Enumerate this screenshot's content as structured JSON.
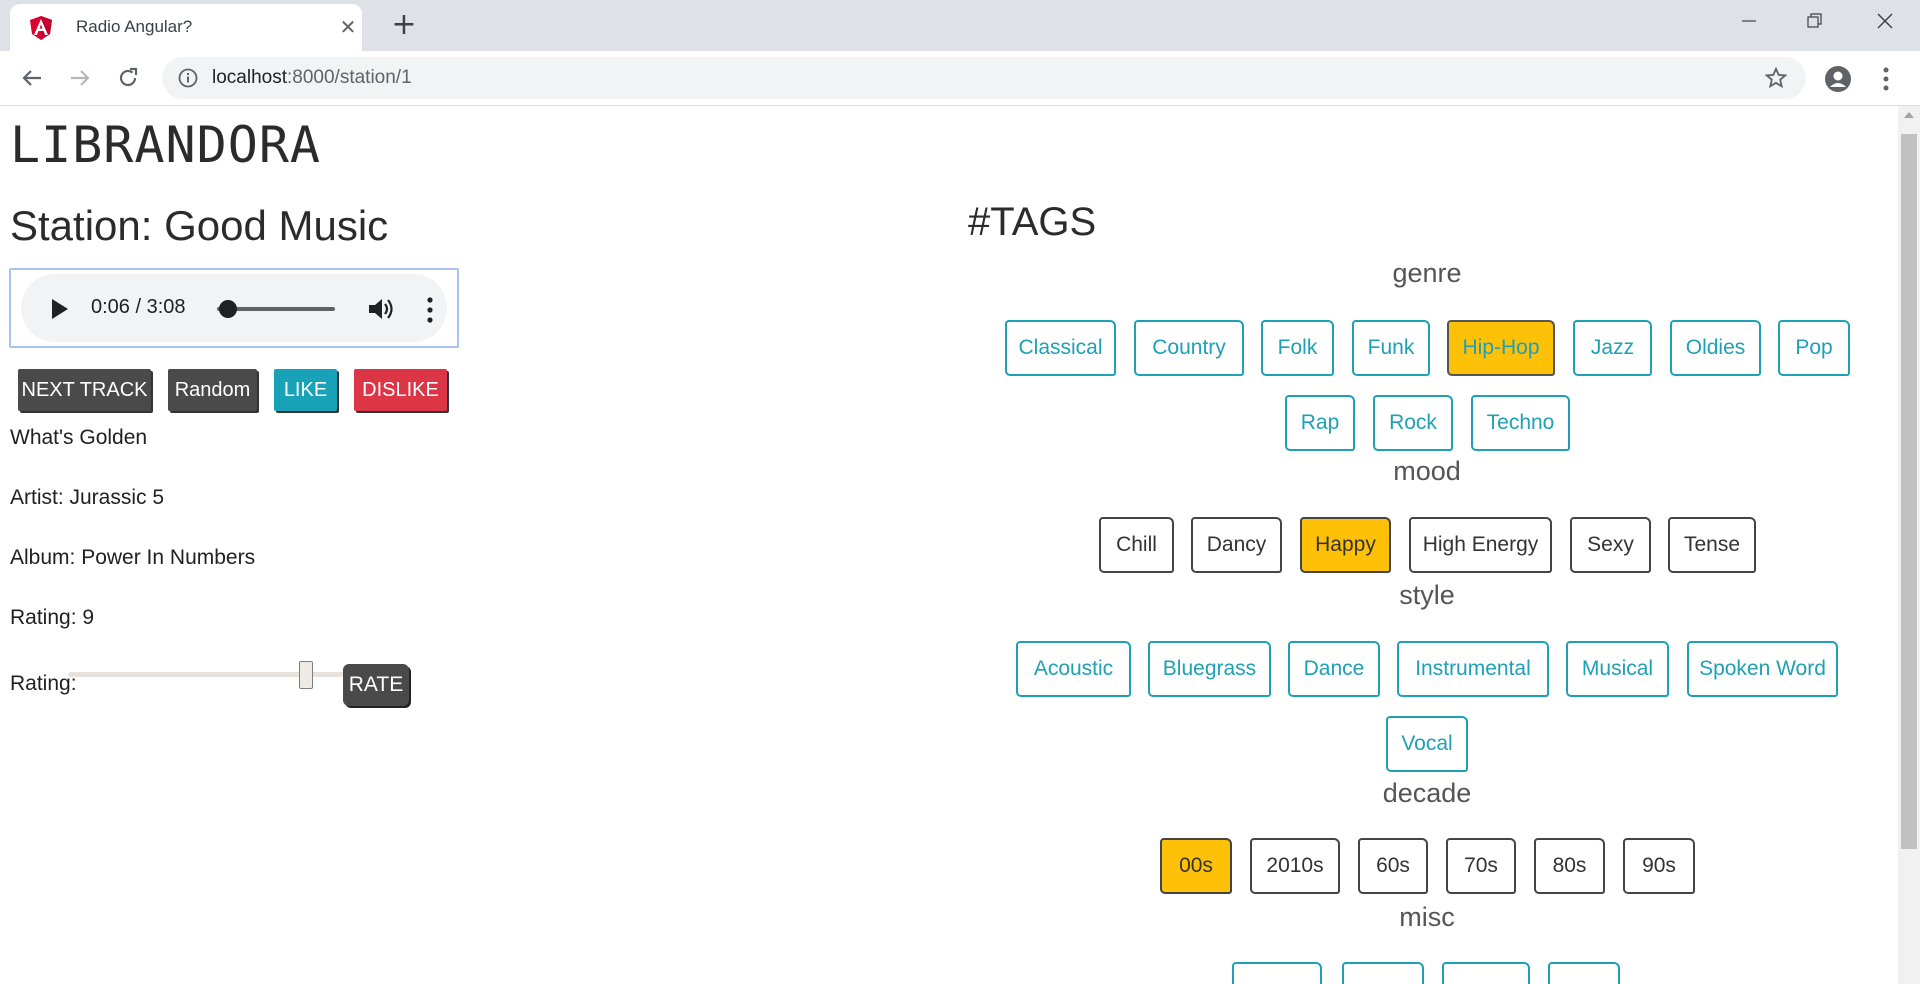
{
  "browser": {
    "tab_title": "Radio Angular?",
    "url_host": "localhost",
    "url_path": ":8000/station/1"
  },
  "page": {
    "brand": "LIBRANDORA",
    "station_title": "Station: Good Music",
    "audio": {
      "time": "0:06 / 3:08",
      "progress": 0.03
    },
    "buttons": {
      "next": "NEXT TRACK",
      "random": "Random",
      "like": "LIKE",
      "dislike": "DISLIKE"
    },
    "track": {
      "title": "What's Golden",
      "artist": "Artist: Jurassic 5",
      "album": "Album: Power In Numbers",
      "rating": "Rating: 9"
    },
    "rating_control": {
      "label": "Rating:",
      "value": 9,
      "button": "RATE"
    }
  },
  "tags": {
    "title": "#TAGS",
    "sections": [
      {
        "name": "genre",
        "items": [
          "Classical",
          "Country",
          "Folk",
          "Funk",
          "Hip-Hop",
          "Jazz",
          "Oldies",
          "Pop",
          "Rap",
          "Rock",
          "Techno"
        ],
        "selected": [
          "Hip-Hop"
        ]
      },
      {
        "name": "mood",
        "items": [
          "Chill",
          "Dancy",
          "Happy",
          "High Energy",
          "Sexy",
          "Tense"
        ],
        "selected": [
          "Happy"
        ]
      },
      {
        "name": "style",
        "items": [
          "Acoustic",
          "Bluegrass",
          "Dance",
          "Instrumental",
          "Musical",
          "Spoken Word",
          "Vocal"
        ],
        "selected": []
      },
      {
        "name": "decade",
        "items": [
          "00s",
          "2010s",
          "60s",
          "70s",
          "80s",
          "90s"
        ],
        "selected": [
          "00s"
        ]
      },
      {
        "name": "misc",
        "items": []
      }
    ]
  },
  "colors": {
    "teal": "#1ea0b5",
    "selected": "#ffc107",
    "like": "#17a2b8",
    "dislike": "#dc3545",
    "dark_button": "#4a4a4a"
  }
}
